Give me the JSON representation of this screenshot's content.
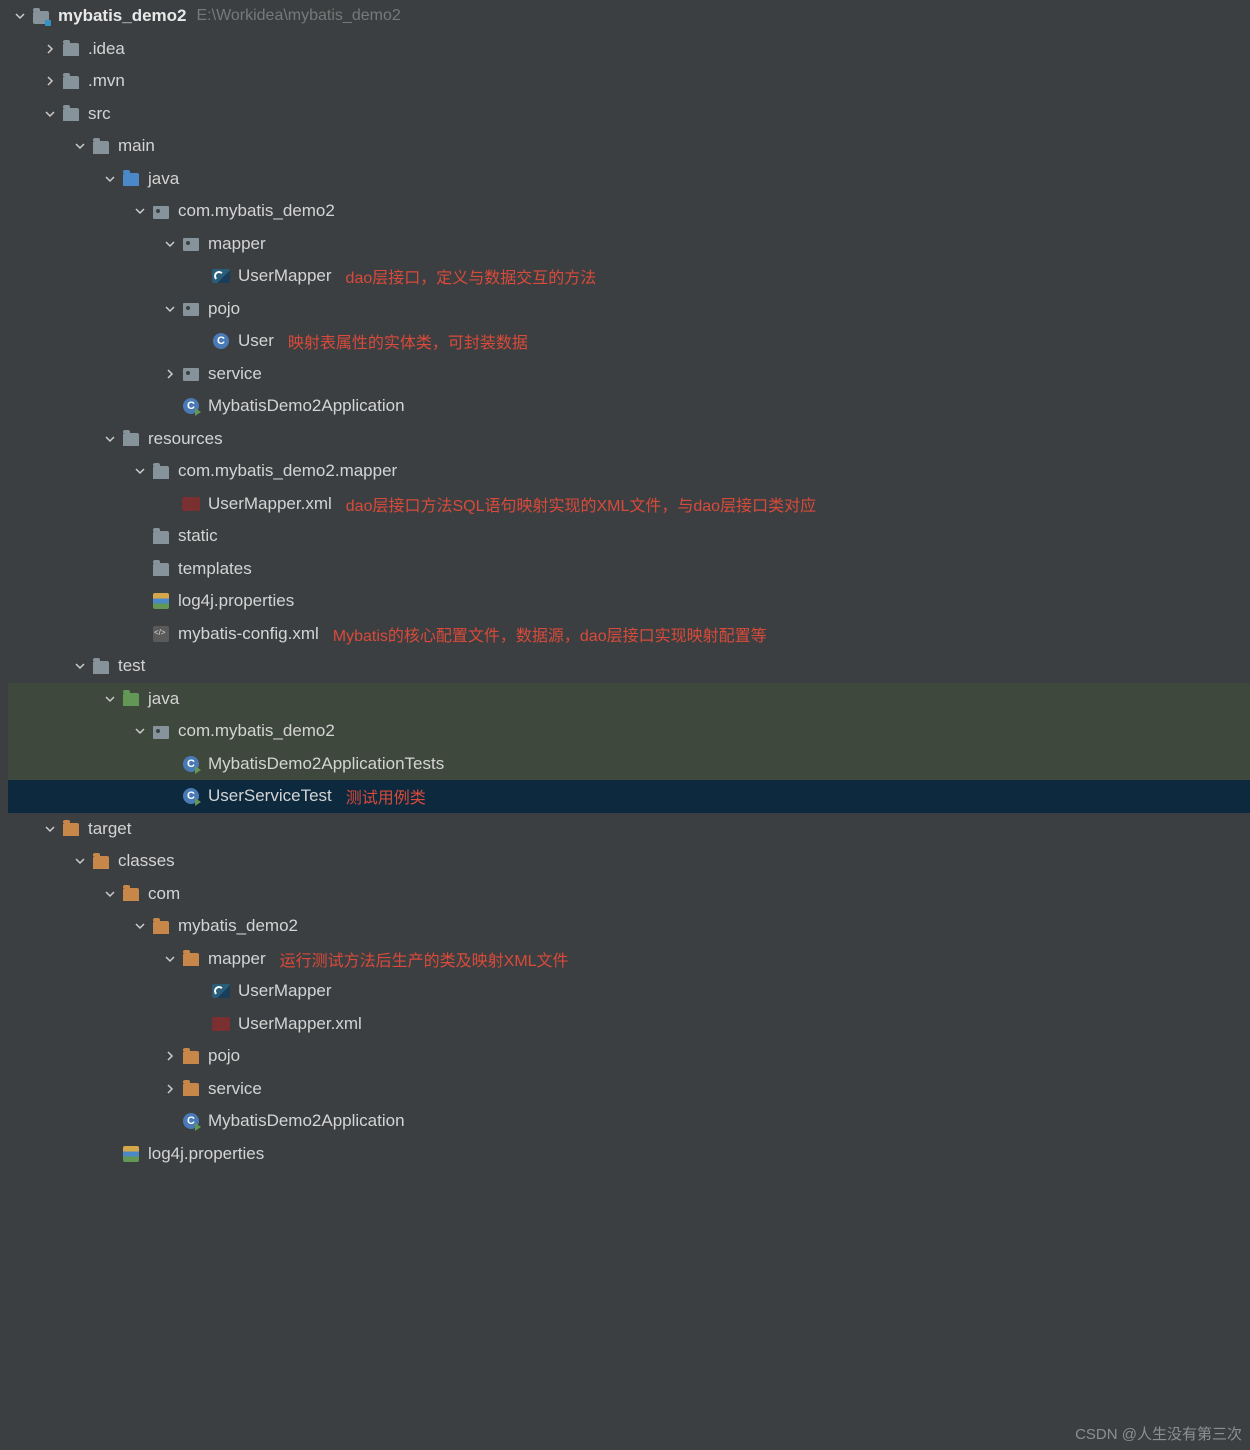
{
  "watermark": "CSDN @人生没有第三次",
  "rows": [
    {
      "depth": 0,
      "chev": "down",
      "icon": "proj",
      "label": "mybatis_demo2",
      "bold": true,
      "hint": "E:\\Workidea\\mybatis_demo2"
    },
    {
      "depth": 1,
      "chev": "right",
      "icon": "folder",
      "label": ".idea"
    },
    {
      "depth": 1,
      "chev": "right",
      "icon": "folder",
      "label": ".mvn"
    },
    {
      "depth": 1,
      "chev": "down",
      "icon": "folder",
      "label": "src"
    },
    {
      "depth": 2,
      "chev": "down",
      "icon": "folder",
      "label": "main"
    },
    {
      "depth": 3,
      "chev": "down",
      "icon": "folder-blue",
      "label": "java"
    },
    {
      "depth": 4,
      "chev": "down",
      "icon": "pkg",
      "label": "com.mybatis_demo2"
    },
    {
      "depth": 5,
      "chev": "down",
      "icon": "pkg",
      "label": "mapper"
    },
    {
      "depth": 6,
      "chev": "",
      "icon": "interface",
      "label": "UserMapper",
      "annot": "dao层接口，定义与数据交互的方法"
    },
    {
      "depth": 5,
      "chev": "down",
      "icon": "pkg",
      "label": "pojo"
    },
    {
      "depth": 6,
      "chev": "",
      "icon": "class",
      "label": "User",
      "annot": "映射表属性的实体类，可封装数据"
    },
    {
      "depth": 5,
      "chev": "right",
      "icon": "pkg",
      "label": "service"
    },
    {
      "depth": 5,
      "chev": "",
      "icon": "class-run",
      "label": "MybatisDemo2Application"
    },
    {
      "depth": 3,
      "chev": "down",
      "icon": "folder-res",
      "label": "resources"
    },
    {
      "depth": 4,
      "chev": "down",
      "icon": "folder",
      "label": "com.mybatis_demo2.mapper"
    },
    {
      "depth": 5,
      "chev": "",
      "icon": "xml",
      "label": "UserMapper.xml",
      "annot": "dao层接口方法SQL语句映射实现的XML文件，与dao层接口类对应"
    },
    {
      "depth": 4,
      "chev": "",
      "icon": "folder",
      "label": "static"
    },
    {
      "depth": 4,
      "chev": "",
      "icon": "folder",
      "label": "templates"
    },
    {
      "depth": 4,
      "chev": "",
      "icon": "prop",
      "label": "log4j.properties"
    },
    {
      "depth": 4,
      "chev": "",
      "icon": "xmlcfg",
      "label": "mybatis-config.xml",
      "annot": "Mybatis的核心配置文件，数据源，dao层接口实现映射配置等"
    },
    {
      "depth": 2,
      "chev": "down",
      "icon": "folder",
      "label": "test"
    },
    {
      "depth": 3,
      "chev": "down",
      "icon": "folder-green",
      "label": "java",
      "testbg": true
    },
    {
      "depth": 4,
      "chev": "down",
      "icon": "pkg",
      "label": "com.mybatis_demo2",
      "testbg": true
    },
    {
      "depth": 5,
      "chev": "",
      "icon": "class-run",
      "label": "MybatisDemo2ApplicationTests",
      "testbg": true
    },
    {
      "depth": 5,
      "chev": "",
      "icon": "class-run",
      "label": "UserServiceTest",
      "annot": "测试用例类",
      "selected": true
    },
    {
      "depth": 1,
      "chev": "down",
      "icon": "folder-orange",
      "label": "target"
    },
    {
      "depth": 2,
      "chev": "down",
      "icon": "folder-orange",
      "label": "classes"
    },
    {
      "depth": 3,
      "chev": "down",
      "icon": "folder-orange",
      "label": "com"
    },
    {
      "depth": 4,
      "chev": "down",
      "icon": "folder-orange",
      "label": "mybatis_demo2"
    },
    {
      "depth": 5,
      "chev": "down",
      "icon": "folder-orange",
      "label": "mapper",
      "annot": "运行测试方法后生产的类及映射XML文件"
    },
    {
      "depth": 6,
      "chev": "",
      "icon": "interface",
      "label": "UserMapper"
    },
    {
      "depth": 6,
      "chev": "",
      "icon": "xml",
      "label": "UserMapper.xml"
    },
    {
      "depth": 5,
      "chev": "right",
      "icon": "folder-orange",
      "label": "pojo"
    },
    {
      "depth": 5,
      "chev": "right",
      "icon": "folder-orange",
      "label": "service"
    },
    {
      "depth": 5,
      "chev": "",
      "icon": "class-run",
      "label": "MybatisDemo2Application"
    },
    {
      "depth": 3,
      "chev": "",
      "icon": "prop",
      "label": "log4j.properties"
    }
  ]
}
